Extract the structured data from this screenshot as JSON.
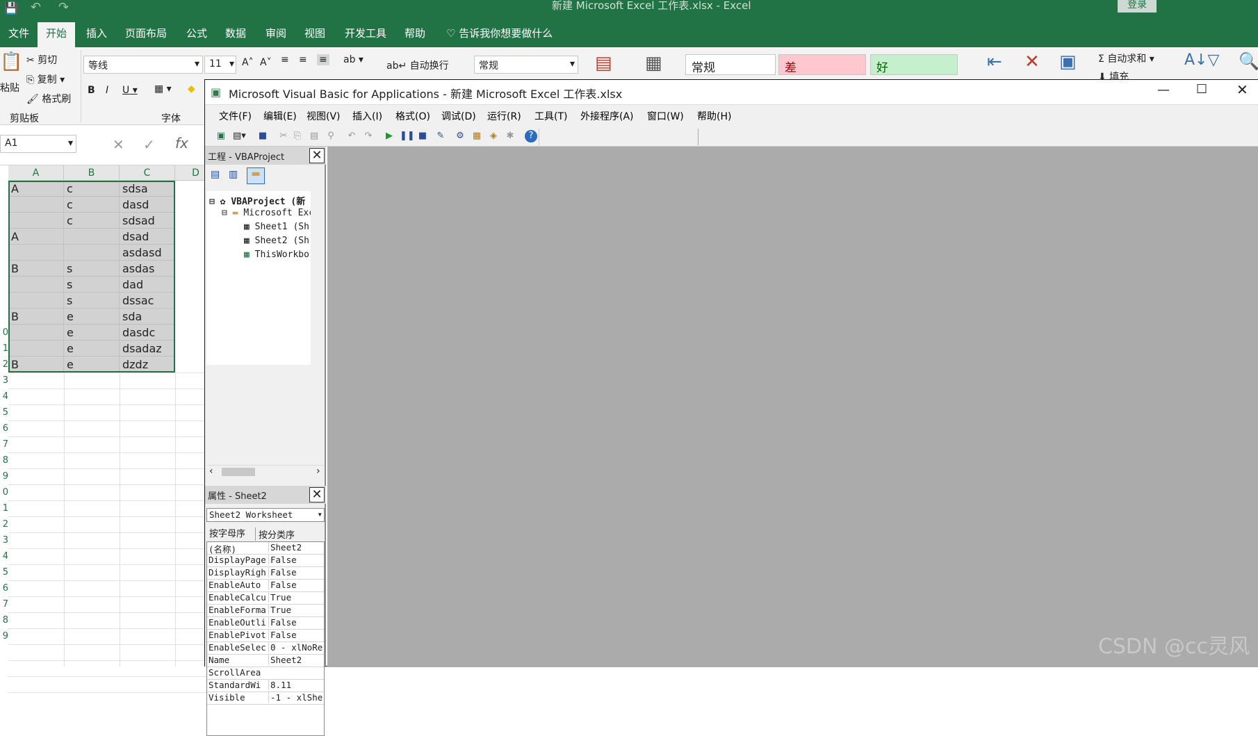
{
  "excel": {
    "title": "新建 Microsoft Excel 工作表.xlsx  -  Excel",
    "login": "登录",
    "tabs": [
      "文件",
      "开始",
      "插入",
      "页面布局",
      "公式",
      "数据",
      "审阅",
      "视图",
      "开发工具",
      "帮助"
    ],
    "active_tab": "开始",
    "tell_me": "告诉我你想要做什么",
    "ribbon": {
      "paste": "粘贴",
      "cut": "剪切",
      "copy": "复制",
      "format_painter": "格式刷",
      "clipboard_group": "剪贴板",
      "font_name": "等线",
      "font_size": "11",
      "font_group": "字体",
      "wrap_text": "自动换行",
      "number_format": "常规",
      "style_normal": "常规",
      "style_bad": "差",
      "style_good": "好",
      "autosum": "自动求和",
      "fill": "填充"
    },
    "name_box": "A1",
    "columns": [
      "A",
      "B",
      "C",
      "D"
    ],
    "rows": [
      [
        "A",
        "c",
        "sdsa"
      ],
      [
        "",
        "c",
        "dasd"
      ],
      [
        "",
        "c",
        "sdsad"
      ],
      [
        "A",
        "",
        "dsad"
      ],
      [
        "",
        "",
        "asdasd"
      ],
      [
        "B",
        "s",
        "asdas"
      ],
      [
        "",
        "s",
        "dad"
      ],
      [
        "",
        "s",
        "dssac"
      ],
      [
        "B",
        "e",
        "sda"
      ],
      [
        "",
        "e",
        "dasdc"
      ],
      [
        "",
        "e",
        "dsadaz"
      ],
      [
        "B",
        "e",
        "dzdz"
      ]
    ],
    "row_numbers": [
      "",
      "",
      "",
      "",
      "",
      "",
      "",
      "",
      "",
      "0",
      "1",
      "2",
      "3",
      "4",
      "5",
      "6",
      "7",
      "8",
      "9",
      "0",
      "1",
      "2",
      "3",
      "4",
      "5",
      "6",
      "7",
      "8",
      "9"
    ]
  },
  "vba": {
    "title": "Microsoft Visual Basic for Applications - 新建 Microsoft Excel 工作表.xlsx",
    "menu": [
      "文件(F)",
      "编辑(E)",
      "视图(V)",
      "插入(I)",
      "格式(O)",
      "调试(D)",
      "运行(R)",
      "工具(T)",
      "外接程序(A)",
      "窗口(W)",
      "帮助(H)"
    ],
    "project_panel_title": "工程 - VBAProject",
    "tree": [
      {
        "label": "VBAProject (新",
        "indent": 0,
        "bold": true
      },
      {
        "label": "Microsoft Exc",
        "indent": 1,
        "bold": false
      },
      {
        "label": "Sheet1 (Sh",
        "indent": 2,
        "bold": false
      },
      {
        "label": "Sheet2 (Sh",
        "indent": 2,
        "bold": false
      },
      {
        "label": "ThisWorkbo",
        "indent": 2,
        "bold": false
      }
    ],
    "properties_panel_title": "属性 - Sheet2",
    "object_select": "Sheet2 Worksheet",
    "prop_tabs": [
      "按字母序",
      "按分类序"
    ],
    "properties": [
      [
        "(名称)",
        "Sheet2"
      ],
      [
        "DisplayPage",
        "False"
      ],
      [
        "DisplayRigh",
        "False"
      ],
      [
        "EnableAuto",
        "False"
      ],
      [
        "EnableCalcu",
        "True"
      ],
      [
        "EnableForma",
        "True"
      ],
      [
        "EnableOutli",
        "False"
      ],
      [
        "EnablePivot",
        "False"
      ],
      [
        "EnableSelec",
        "0 - xlNoRe"
      ],
      [
        "Name",
        "Sheet2"
      ],
      [
        "ScrollArea",
        ""
      ],
      [
        "StandardWi",
        "8.11"
      ],
      [
        "Visible",
        "-1 - xlShe"
      ]
    ]
  },
  "watermark": "CSDN @cc灵风"
}
